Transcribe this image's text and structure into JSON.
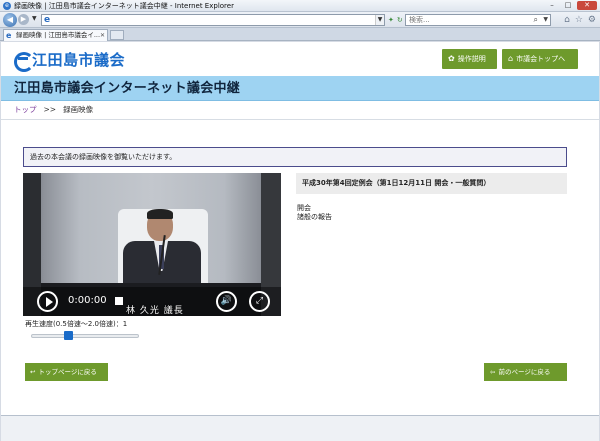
{
  "browser": {
    "window_title": "録画映像 | 江田島市議会インターネット議会中継 - Internet Explorer",
    "address_value": "",
    "search_placeholder": "検索...",
    "tab_title": "録画映像 | 江田島市議会イ...",
    "icons": [
      "back-icon",
      "forward-icon",
      "ie-logo-icon",
      "refresh-icon",
      "search-icon",
      "home-icon",
      "favorites-icon",
      "settings-icon"
    ]
  },
  "header": {
    "logo_text": "江田島市議会",
    "guide_button": "操作説明",
    "top_button": "市議会トップへ"
  },
  "banner": {
    "title": "江田島市議会インターネット議会中継"
  },
  "breadcrumb": {
    "home": "トップ",
    "separator": ">>",
    "current": "録画映像"
  },
  "notice": "過去の本会議の録画映像を御覧いただけます。",
  "video": {
    "time": "0:00:00",
    "caption": "林 久光 議長",
    "progress": 0
  },
  "speed": {
    "label": "再生速度(0.5倍速～2.0倍速)：1",
    "value": 1,
    "min": 0.5,
    "max": 2.0
  },
  "session": {
    "title": "平成30年第4回定例会（第1日12月11日 開会・一般質問）",
    "agenda": [
      "開会",
      "諸般の報告"
    ]
  },
  "footer_buttons": {
    "home": "トップページに戻る",
    "prev": "前のページに戻る"
  },
  "colors": {
    "brand_blue": "#1a6bc8",
    "green_button": "#6e9a2c",
    "banner": "#9ed3f2"
  }
}
